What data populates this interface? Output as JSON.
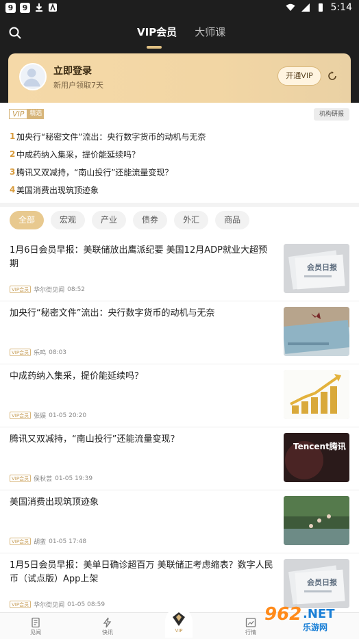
{
  "status_bar": {
    "left_icons": [
      "9",
      "9"
    ],
    "time": "5:14"
  },
  "header": {
    "tabs": [
      {
        "label": "VIP会员",
        "active": true
      },
      {
        "label": "大师课",
        "active": false
      }
    ]
  },
  "login": {
    "title": "立即登录",
    "subtitle": "新用户领取7天",
    "vip_button": "开通VIP"
  },
  "vip_selection": {
    "logo_vip": "VIP",
    "logo_tag": "精选",
    "research_button": "机构研报",
    "items": [
      {
        "num": "1",
        "text": "加央行“秘密文件”流出：央行数字货币的动机与无奈"
      },
      {
        "num": "2",
        "text": "中成药纳入集采，提价能延续吗？"
      },
      {
        "num": "3",
        "text": "腾讯又双减持，“南山投行”还能流量变现？"
      },
      {
        "num": "4",
        "text": "美国消费出现筑顶迹象"
      }
    ]
  },
  "filters": [
    "全部",
    "宏观",
    "产业",
    "债券",
    "外汇",
    "商品"
  ],
  "articles": [
    {
      "title": "1月6日会员早报：美联储放出鹰派纪要 美国12月ADP就业大超预期",
      "tag": "VIP会员",
      "source": "华尔街见闻",
      "time": "08:52",
      "thumb": "newspaper"
    },
    {
      "title": "加央行“秘密文件”流出：央行数字货币的动机与无奈",
      "tag": "VIP会员",
      "source": "乐鸣",
      "time": "08:03",
      "thumb": "banknote"
    },
    {
      "title": "中成药纳入集采，提价能延续吗？",
      "tag": "VIP会员",
      "source": "张娱",
      "time": "01-05 20:20",
      "thumb": "coins"
    },
    {
      "title": "腾讯又双减持，“南山投行”还能流量变现？",
      "tag": "VIP会员",
      "source": "侯秋芸",
      "time": "01-05 19:39",
      "thumb": "tencent"
    },
    {
      "title": "美国消费出现筑顶迹象",
      "tag": "VIP会员",
      "source": "胡蛮",
      "time": "01-05 17:48",
      "thumb": "cliff"
    },
    {
      "title": "1月5日会员早报：美单日确诊超百万 美联储正考虑缩表？数字人民币（试点版）App上架",
      "tag": "VIP会员",
      "source": "华尔街见闻",
      "time": "01-05 08:59",
      "thumb": "newspaper"
    }
  ],
  "thumb_text": {
    "newspaper": "会员日报",
    "tencent": "Tencent腾讯"
  },
  "bottom_nav": [
    {
      "label": "见闻"
    },
    {
      "label": "快讯"
    },
    {
      "label": "VIP"
    },
    {
      "label": "行情"
    }
  ],
  "watermark": {
    "num": "962",
    "net": ".NET",
    "sub": "乐游网"
  },
  "colors": {
    "accent_gold": "#e8c98f",
    "header_bg": "#1e1e1e",
    "number_orange": "#d89b3c"
  }
}
